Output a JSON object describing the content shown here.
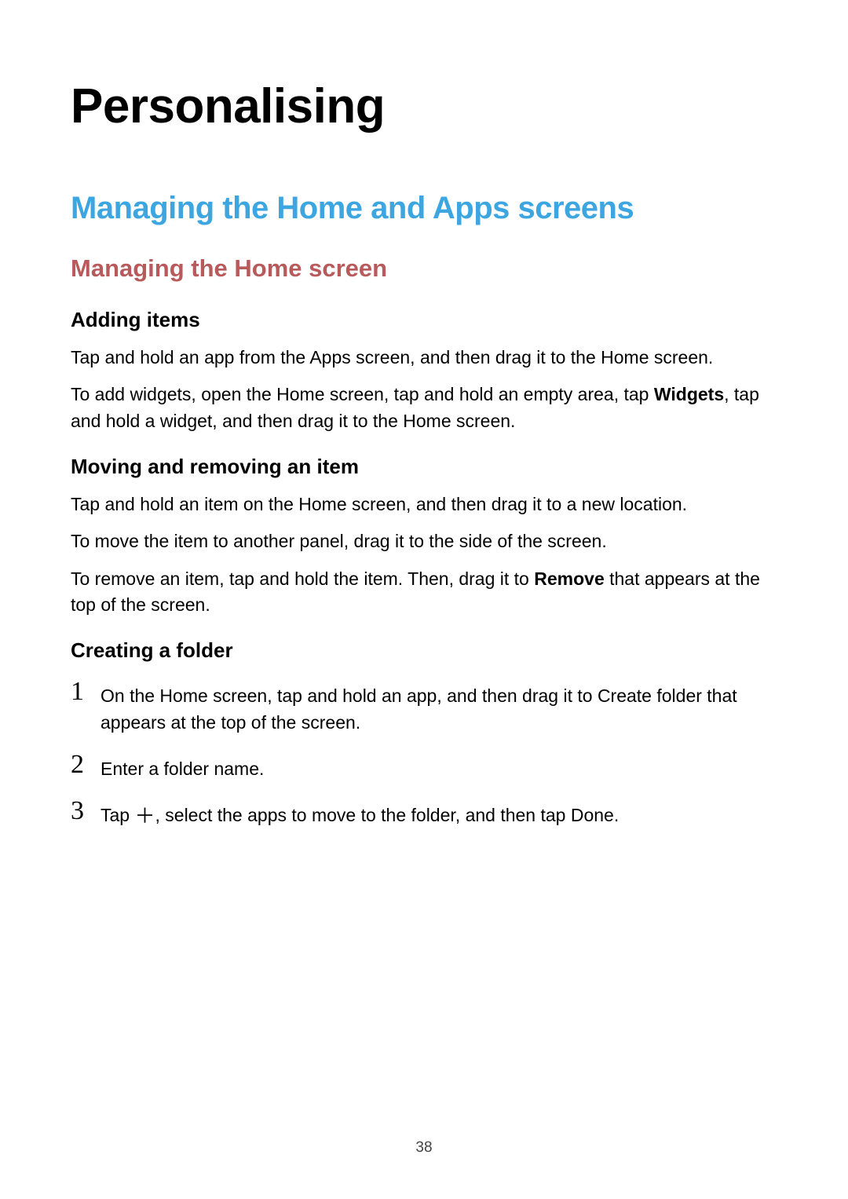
{
  "page": {
    "title": "Personalising",
    "number": "38"
  },
  "section": {
    "heading": "Managing the Home and Apps screens"
  },
  "subsection": {
    "heading": "Managing the Home screen"
  },
  "topics": {
    "adding": {
      "heading": "Adding items",
      "p1": "Tap and hold an app from the Apps screen, and then drag it to the Home screen.",
      "p2_a": "To add widgets, open the Home screen, tap and hold an empty area, tap ",
      "p2_bold": "Widgets",
      "p2_b": ", tap and hold a widget, and then drag it to the Home screen."
    },
    "moving": {
      "heading": "Moving and removing an item",
      "p1": "Tap and hold an item on the Home screen, and then drag it to a new location.",
      "p2": "To move the item to another panel, drag it to the side of the screen.",
      "p3_a": "To remove an item, tap and hold the item. Then, drag it to ",
      "p3_bold": "Remove",
      "p3_b": " that appears at the top of the screen."
    },
    "folder": {
      "heading": "Creating a folder",
      "steps": {
        "n1": "1",
        "s1_a": "On the Home screen, tap and hold an app, and then drag it to ",
        "s1_bold": "Create folder",
        "s1_b": " that appears at the top of the screen.",
        "n2": "2",
        "s2": "Enter a folder name.",
        "n3": "3",
        "s3_a": "Tap ",
        "s3_plus": "＋",
        "s3_b": ", select the apps to move to the folder, and then tap ",
        "s3_bold": "Done",
        "s3_c": "."
      }
    }
  }
}
